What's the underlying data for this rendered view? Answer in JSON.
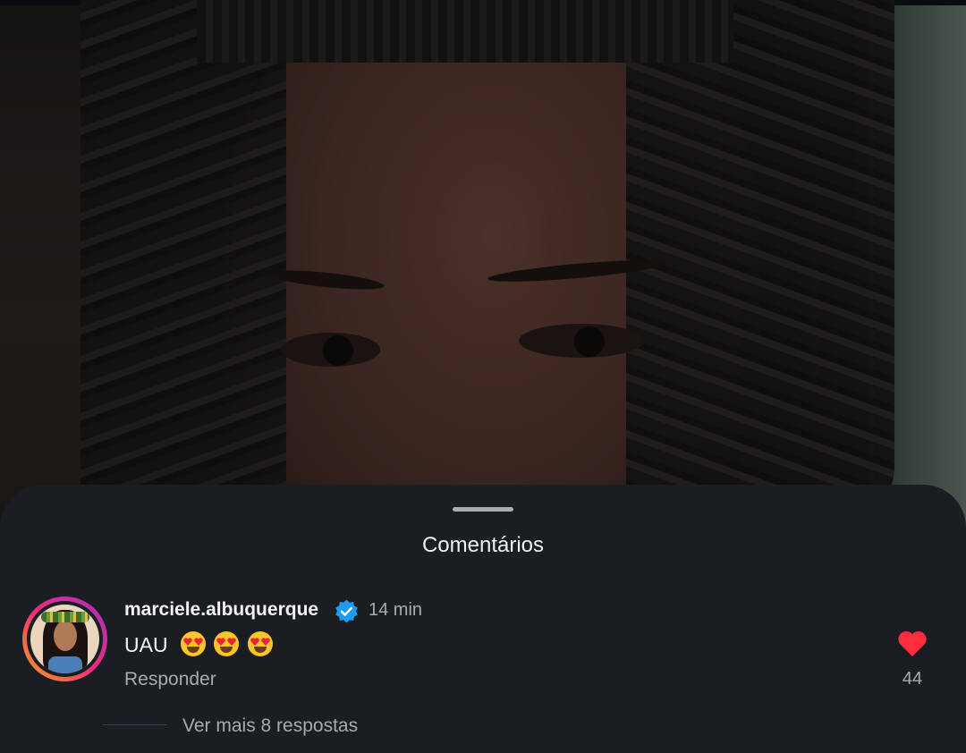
{
  "video": {
    "description_icon": "video-frame"
  },
  "comments_sheet": {
    "title": "Comentários",
    "comment": {
      "username": "marciele.albuquerque",
      "verified_icon": "verified-badge-icon",
      "time": "14 min",
      "text": "UAU",
      "emojis": [
        "😍",
        "😍",
        "😍"
      ],
      "reply_label": "Responder",
      "like_icon": "heart-icon",
      "like_count": "44"
    },
    "view_replies_label": "Ver mais 8 respostas"
  },
  "colors": {
    "sheet_background": "#1a1d22",
    "heart": "#ff2d3d",
    "verified": "#1d9bf0",
    "muted_text": "#a8abb0"
  }
}
